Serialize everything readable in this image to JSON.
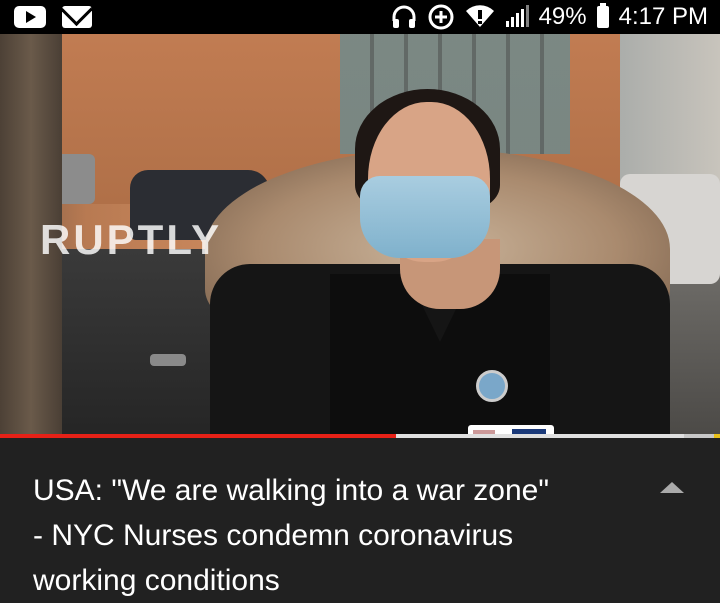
{
  "status_bar": {
    "battery_percent": "49%",
    "time": "4:17 PM"
  },
  "video": {
    "watermark": "RUPTLY",
    "progress_played_fraction": 0.55,
    "progress_buffered_fraction": 0.95
  },
  "info": {
    "title_line_1": "USA: \"We are walking into a war zone\"",
    "title_line_2": "- NYC Nurses condemn coronavirus",
    "title_line_3": "working conditions"
  },
  "colors": {
    "progress_played": "#e62117",
    "panel_bg": "#212121",
    "title_text": "#ffffff"
  },
  "icons": [
    "youtube-icon",
    "mail-icon",
    "headphones-icon",
    "data-saver-icon",
    "wifi-icon",
    "signal-icon",
    "battery-icon",
    "collapse-arrow-icon"
  ]
}
